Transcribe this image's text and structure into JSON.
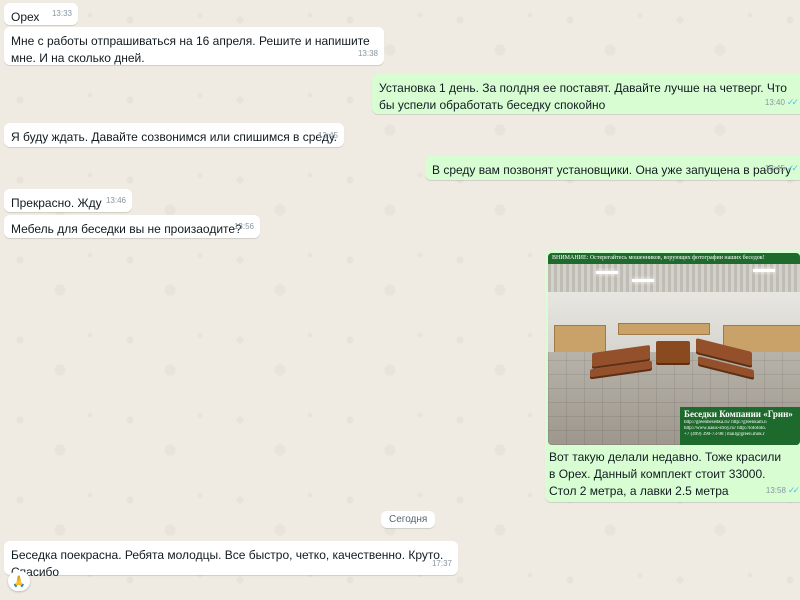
{
  "messages": [
    {
      "text": "Орех",
      "time": "13:33"
    },
    {
      "text": "Мне с работы отпрашиваться на 16 апреля. Решите и напишите мне. И на сколько дней.",
      "time": "13:38"
    },
    {
      "text": "Установка 1 день. За полдня ее поставят. Давайте лучше на четверг. Что бы успели обработать беседку спокойно",
      "time": "13:40"
    },
    {
      "text": "Я буду ждать. Давайте созвонимся или спишимся в среду.",
      "time": "13:45"
    },
    {
      "text": "В среду вам позвонят установщики. Она уже запущена в работу",
      "time": "13:45"
    },
    {
      "text": "Прекрасно. Жду",
      "time": "13:46"
    },
    {
      "text": "Мебель для беседки вы не произаодите?",
      "time": "13:56"
    },
    {
      "text": "Вот такую делали недавно. Тоже красили в Орех. Данный комплект стоит 33000. Стол 2 метра, а лавки 2.5 метра",
      "time": "13:58",
      "image": {
        "banner": "ВНИМАНИЕ: Остерегайтесь мошенников, ворующих фотографии наших беседок!",
        "caption_title": "Беседки Компании «Грин»",
        "caption_lines": [
          "http://greenbesedka.ru/ http://greenkam.n",
          "http://www.nasis-stroy.ru/  http://lotofoto.",
          "+7 (499) 390-73-98 | mail@green.mok.r"
        ]
      }
    },
    {
      "text": "Беседка поекрасна. Ребята молодцы. Все быстро, четко, качественно. Круто. Спасибо",
      "time": "17:37"
    }
  ],
  "date_separator": "Сегодня",
  "reaction": "🙏",
  "status_icon": "double-check-icon",
  "colors": {
    "incoming": "#ffffff",
    "outgoing": "#d9fdd3",
    "read_check": "#53bdeb",
    "background": "#efeae2"
  }
}
